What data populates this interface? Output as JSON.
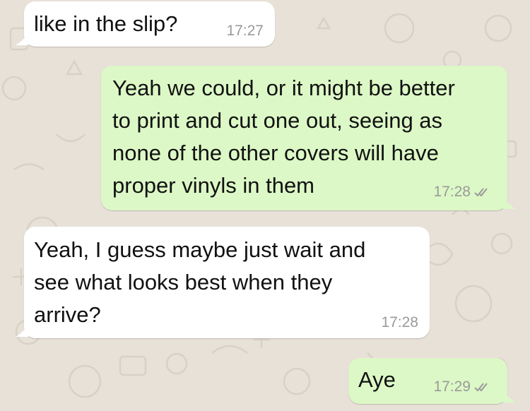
{
  "messages": [
    {
      "direction": "incoming",
      "text": "like in the slip?",
      "time": "17:27"
    },
    {
      "direction": "outgoing",
      "text": "Yeah we could, or it might be better\nto print and cut one out, seeing as\nnone of the other covers will have\nproper vinyls in them",
      "time": "17:28",
      "status_icon": "double-check-icon"
    },
    {
      "direction": "incoming",
      "text": "Yeah, I guess maybe just wait and\nsee what looks best when they\narrive?",
      "time": "17:28"
    },
    {
      "direction": "outgoing",
      "text": "Aye",
      "time": "17:29",
      "status_icon": "double-check-icon"
    }
  ],
  "colors": {
    "background": "#e7e1d8",
    "incoming_bubble": "#ffffff",
    "outgoing_bubble": "#dcf8c6",
    "timestamp": "#9a9a9a",
    "read_tick": "#9a9a9a"
  }
}
